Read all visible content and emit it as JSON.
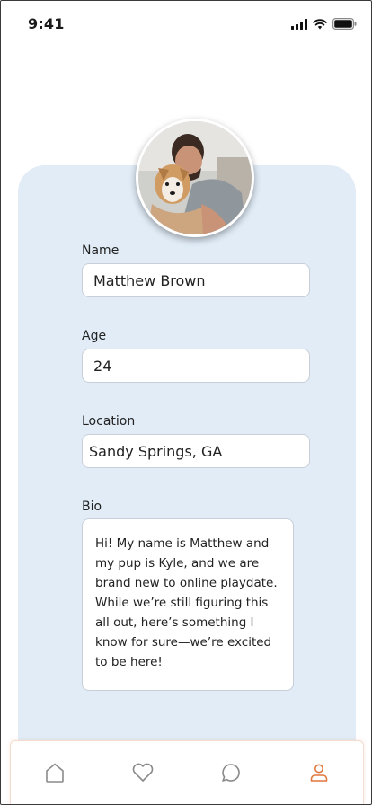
{
  "status_bar": {
    "time": "9:41"
  },
  "profile": {
    "name_label": "Name",
    "name_value": "Matthew Brown",
    "age_label": "Age",
    "age_value": "24",
    "location_label": "Location",
    "location_value": "Sandy Springs, GA",
    "bio_label": "Bio",
    "bio_value": "Hi! My name is Matthew and my pup is Kyle, and we are brand new to online playdate. While we’re still figuring this all out, here’s something I know for sure—we’re excited to be here!"
  },
  "tab_bar": {
    "items": [
      {
        "icon": "home-icon",
        "active": false
      },
      {
        "icon": "heart-icon",
        "active": false
      },
      {
        "icon": "chat-icon",
        "active": false
      },
      {
        "icon": "profile-icon",
        "active": true
      }
    ],
    "active_color": "#e0773b",
    "inactive_color": "#8a8a8a"
  },
  "colors": {
    "card_background": "#e1ecf7"
  }
}
